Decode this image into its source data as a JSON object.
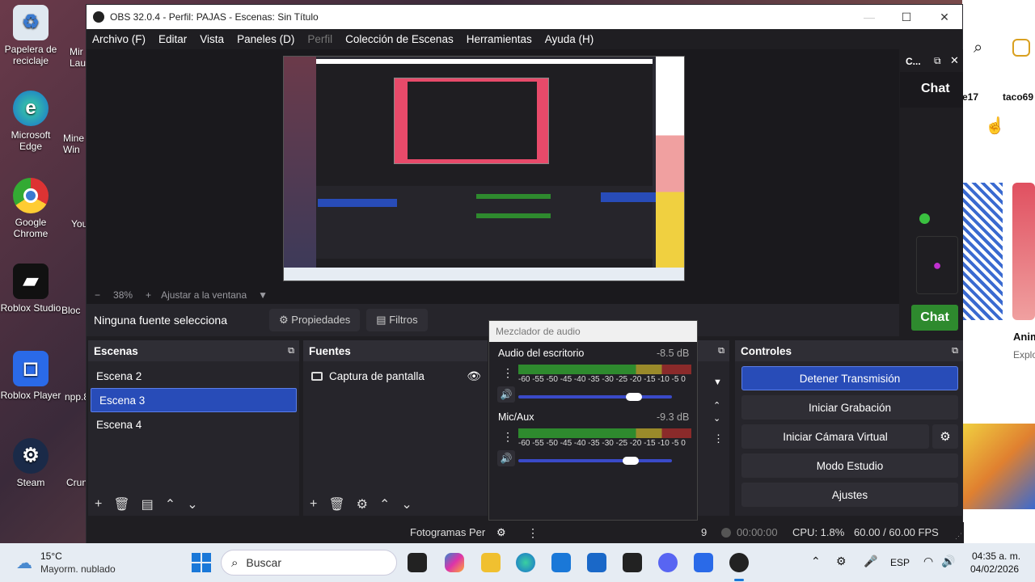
{
  "desktop": {
    "icons": [
      {
        "label": "Papelera de reciclaje"
      },
      {
        "label": "Microsoft Edge"
      },
      {
        "label": "Google Chrome"
      },
      {
        "label": "Roblox Studio"
      },
      {
        "label": "Roblox Player"
      },
      {
        "label": "Steam"
      }
    ],
    "partial_labels": [
      "Mir Lau",
      "Mine Win",
      "You",
      "Bloc",
      "npp.8",
      "Crun"
    ]
  },
  "browser_strip": {
    "user1": "e17",
    "user2": "taco69",
    "card_title": "Anim",
    "card_sub": "Explo"
  },
  "window": {
    "title": "OBS 32.0.4 - Perfil: PAJAS - Escenas: Sin Título",
    "minimize": "—",
    "maximize": "☐",
    "close": "✕"
  },
  "menu": [
    {
      "label": "Archivo (F)",
      "disabled": false
    },
    {
      "label": "Editar",
      "disabled": false
    },
    {
      "label": "Vista",
      "disabled": false
    },
    {
      "label": "Paneles (D)",
      "disabled": false
    },
    {
      "label": "Perfil",
      "disabled": true
    },
    {
      "label": "Colección de Escenas",
      "disabled": false
    },
    {
      "label": "Herramientas",
      "disabled": false
    },
    {
      "label": "Ayuda (H)",
      "disabled": false
    }
  ],
  "zoom": {
    "minus": "−",
    "level": "38%",
    "plus": "+",
    "fit": "Ajustar a la ventana"
  },
  "chat_dock": {
    "title": "C...",
    "header": "Chat",
    "button": "Chat"
  },
  "source_bar": {
    "none_selected": "Ninguna fuente selecciona",
    "properties": "Propiedades",
    "filters": "Filtros"
  },
  "scenes": {
    "header": "Escenas",
    "items": [
      {
        "label": "Escena 2",
        "selected": false
      },
      {
        "label": "Escena 3",
        "selected": true
      },
      {
        "label": "Escena 4",
        "selected": false
      }
    ]
  },
  "sources": {
    "header": "Fuentes",
    "items": [
      {
        "label": "Captura de pantalla"
      }
    ]
  },
  "mixer": {
    "title": "Mezclador de audio",
    "scale": "-60 -55 -50 -45 -40 -35 -30 -25 -20 -15 -10 -5 0",
    "channels": [
      {
        "name": "Audio del escritorio",
        "db": "-8.5 dB",
        "volume": 0.75
      },
      {
        "name": "Mic/Aux",
        "db": "-9.3 dB",
        "volume": 0.73
      }
    ]
  },
  "controls": {
    "header": "Controles",
    "stop_stream": "Detener Transmisión",
    "start_recording": "Iniciar Grabación",
    "start_virtual_cam": "Iniciar Cámara Virtual",
    "studio_mode": "Modo Estudio",
    "settings": "Ajustes"
  },
  "status": {
    "frames": "Fotogramas Per",
    "partial_count": "9",
    "rec_time": "00:00:00",
    "cpu": "CPU: 1.8%",
    "fps": "60.00 / 60.00 FPS"
  },
  "taskbar": {
    "weather_temp": "15°C",
    "weather_desc": "Mayorm. nublado",
    "search": "Buscar",
    "lang": "ESP",
    "time": "04:35 a. m.",
    "date": "04/02/2026"
  },
  "colors": {
    "accent": "#284cb8",
    "chat_green": "#2e8a2e"
  }
}
